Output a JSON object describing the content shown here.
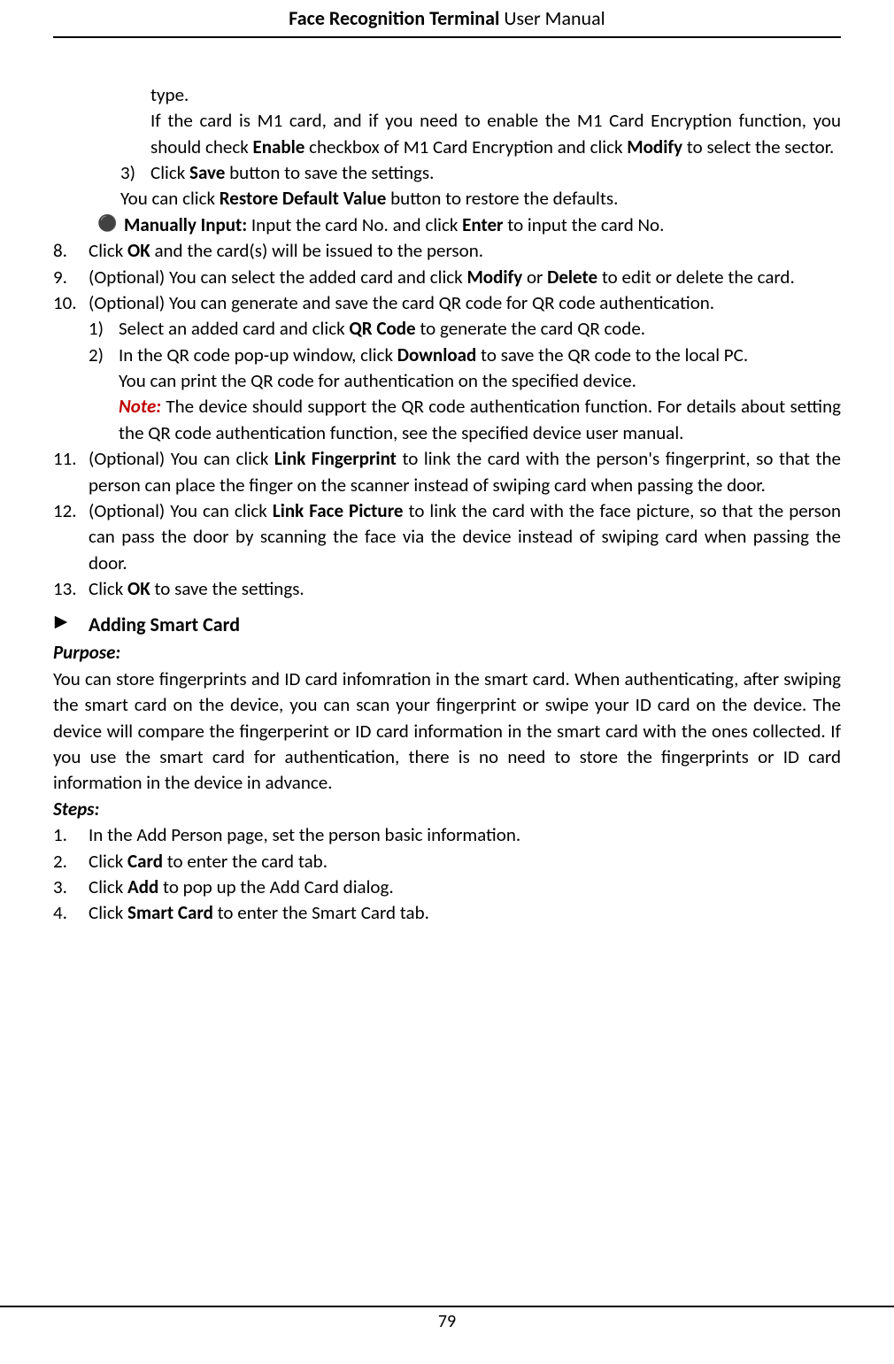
{
  "header": {
    "title_bold": "Face Recognition Terminal",
    "title_rest": "  User Manual"
  },
  "footer": {
    "page_num": "79"
  },
  "line_type": "type.",
  "line_m1_1": "If the card is M1 card, and if you need to enable the M1 Card Encryption function, you should check ",
  "line_m1_b1": "Enable",
  "line_m1_2": " checkbox of M1 Card Encryption and click ",
  "line_m1_b2": "Modify",
  "line_m1_3": " to select the sector.",
  "s3_num": "3)",
  "s3_1": "Click ",
  "s3_b": "Save",
  "s3_2": " button to save the settings.",
  "rd_1": "You can click ",
  "rd_b": "Restore Default Value",
  "rd_2": " button to restore the defaults.",
  "mi_b": "Manually Input:",
  "mi_1": " Input the card No. and click ",
  "mi_b2": "Enter",
  "mi_2": " to input the card No.",
  "n8_num": "8.",
  "n8_1": "Click ",
  "n8_b": "OK",
  "n8_2": " and the card(s) will be issued to the person.",
  "n9_num": "9.",
  "n9_1": "(Optional) You can select the added card and click ",
  "n9_b1": "Modify",
  "n9_2": " or ",
  "n9_b2": "Delete",
  "n9_3": " to edit or delete the card.",
  "n10_num": "10.",
  "n10_t": "(Optional) You can generate and save the card QR code for QR code authentication.",
  "n10_1_num": "1)",
  "n10_1_1": "Select an added card and click ",
  "n10_1_b": "QR Code",
  "n10_1_2": " to generate the card QR code.",
  "n10_2_num": "2)",
  "n10_2_1": "In the QR code pop-up window, click ",
  "n10_2_b": "Download",
  "n10_2_2": " to save the QR code to the local PC.",
  "n10_2_3": "You can print the QR code for authentication on the specified device.",
  "note_label": "Note:",
  "n10_2_4": " The device should support the QR code authentication function. For details about setting the QR code authentication function, see the specified device user manual.",
  "n11_num": "11.",
  "n11_1": "(Optional) You can click ",
  "n11_b": "Link Fingerprint",
  "n11_2": " to link the card with the person's fingerprint, so that the person can place the finger on the scanner instead of swiping card when passing the door.",
  "n12_num": "12.",
  "n12_1": "(Optional) You can click ",
  "n12_b": "Link Face Picture",
  "n12_2": " to link the card with the face picture, so that the person can pass the door by scanning the face via the device instead of swiping card when passing the door.",
  "n13_num": "13.",
  "n13_1": "Click ",
  "n13_b": "OK",
  "n13_2": " to save the settings.",
  "sec_title": "Adding Smart Card",
  "purpose_label": "Purpose:",
  "purpose_text": "You can store fingerprints and ID card infomration in the smart card. When authenticating, after swiping the smart card on the device, you can scan your fingerprint or swipe your ID card on the device. The device will compare the fingerperint or ID card information in the smart card with the ones collected. If you use the smart card for authentication, there is no need to store the fingerprints or ID card information in the device in advance.",
  "steps_label": "Steps:",
  "st1_num": "1.",
  "st1": "In the Add Person page, set the person basic information.",
  "st2_num": "2.",
  "st2_1": "Click ",
  "st2_b": "Card",
  "st2_2": " to enter the card tab.",
  "st3_num": "3.",
  "st3_1": "Click ",
  "st3_b": "Add",
  "st3_2": " to pop up the Add Card dialog.",
  "st4_num": "4.",
  "st4_1": "Click ",
  "st4_b": "Smart Card",
  "st4_2": " to enter the Smart Card tab."
}
